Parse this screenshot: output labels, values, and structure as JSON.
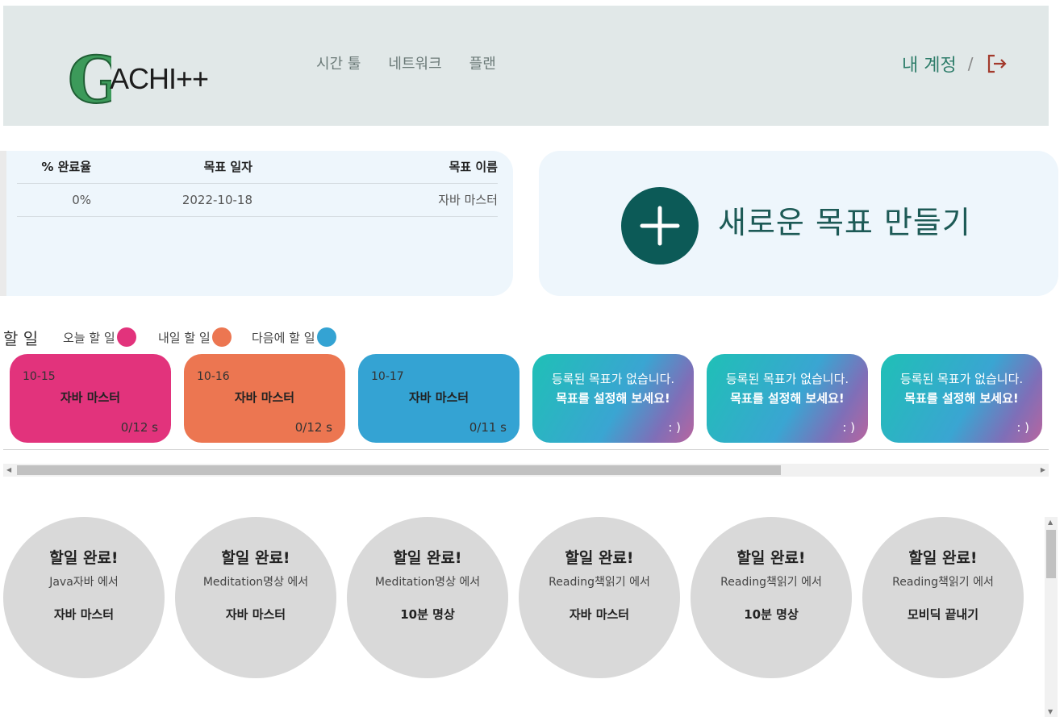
{
  "header": {
    "logo_text": "ACHI++",
    "logo_letter": "G",
    "nav": [
      "시간 툴",
      "네트워크",
      "플랜"
    ],
    "account_label": "내 계정",
    "separator": "/",
    "logout_icon": "logout-icon"
  },
  "goal_table": {
    "columns": [
      "% 완료율",
      "목표 일자",
      "목표 이름"
    ],
    "rows": [
      {
        "percent": "0%",
        "date": "2022-10-18",
        "name": "자바 마스터"
      }
    ]
  },
  "new_goal": {
    "label": "새로운 목표 만들기",
    "icon": "plus-icon"
  },
  "todo": {
    "title": "할 일",
    "legend": [
      {
        "label": "오늘 할 일",
        "color": "#e2337c"
      },
      {
        "label": "내일 할 일",
        "color": "#ec7651"
      },
      {
        "label": "다음에 할 일",
        "color": "#34a3d3"
      }
    ],
    "cards": [
      {
        "date": "10-15",
        "name": "자바 마스터",
        "progress": "0/12 s",
        "color": "#e2337c"
      },
      {
        "date": "10-16",
        "name": "자바 마스터",
        "progress": "0/12 s",
        "color": "#ec7651"
      },
      {
        "date": "10-17",
        "name": "자바 마스터",
        "progress": "0/11 s",
        "color": "#34a3d3"
      }
    ],
    "empty_cards": [
      {
        "line1": "등록된 목표가 없습니다.",
        "line2": "목표를 설정해 보세요!",
        "smile": ": )"
      },
      {
        "line1": "등록된 목표가 없습니다.",
        "line2": "목표를 설정해 보세요!",
        "smile": ": )"
      },
      {
        "line1": "등록된 목표가 없습니다.",
        "line2": "목표를 설정해 보세요!",
        "smile": ": )"
      }
    ]
  },
  "completed": [
    {
      "title": "할일 완료!",
      "source": "Java자바 에서",
      "goal": "자바 마스터"
    },
    {
      "title": "할일 완료!",
      "source": "Meditation명상 에서",
      "goal": "자바 마스터"
    },
    {
      "title": "할일 완료!",
      "source": "Meditation명상 에서",
      "goal": "10분 명상"
    },
    {
      "title": "할일 완료!",
      "source": "Reading책읽기 에서",
      "goal": "자바 마스터"
    },
    {
      "title": "할일 완료!",
      "source": "Reading책읽기 에서",
      "goal": "10분 명상"
    },
    {
      "title": "할일 완료!",
      "source": "Reading책읽기 에서",
      "goal": "모비딕 끝내기"
    }
  ]
}
